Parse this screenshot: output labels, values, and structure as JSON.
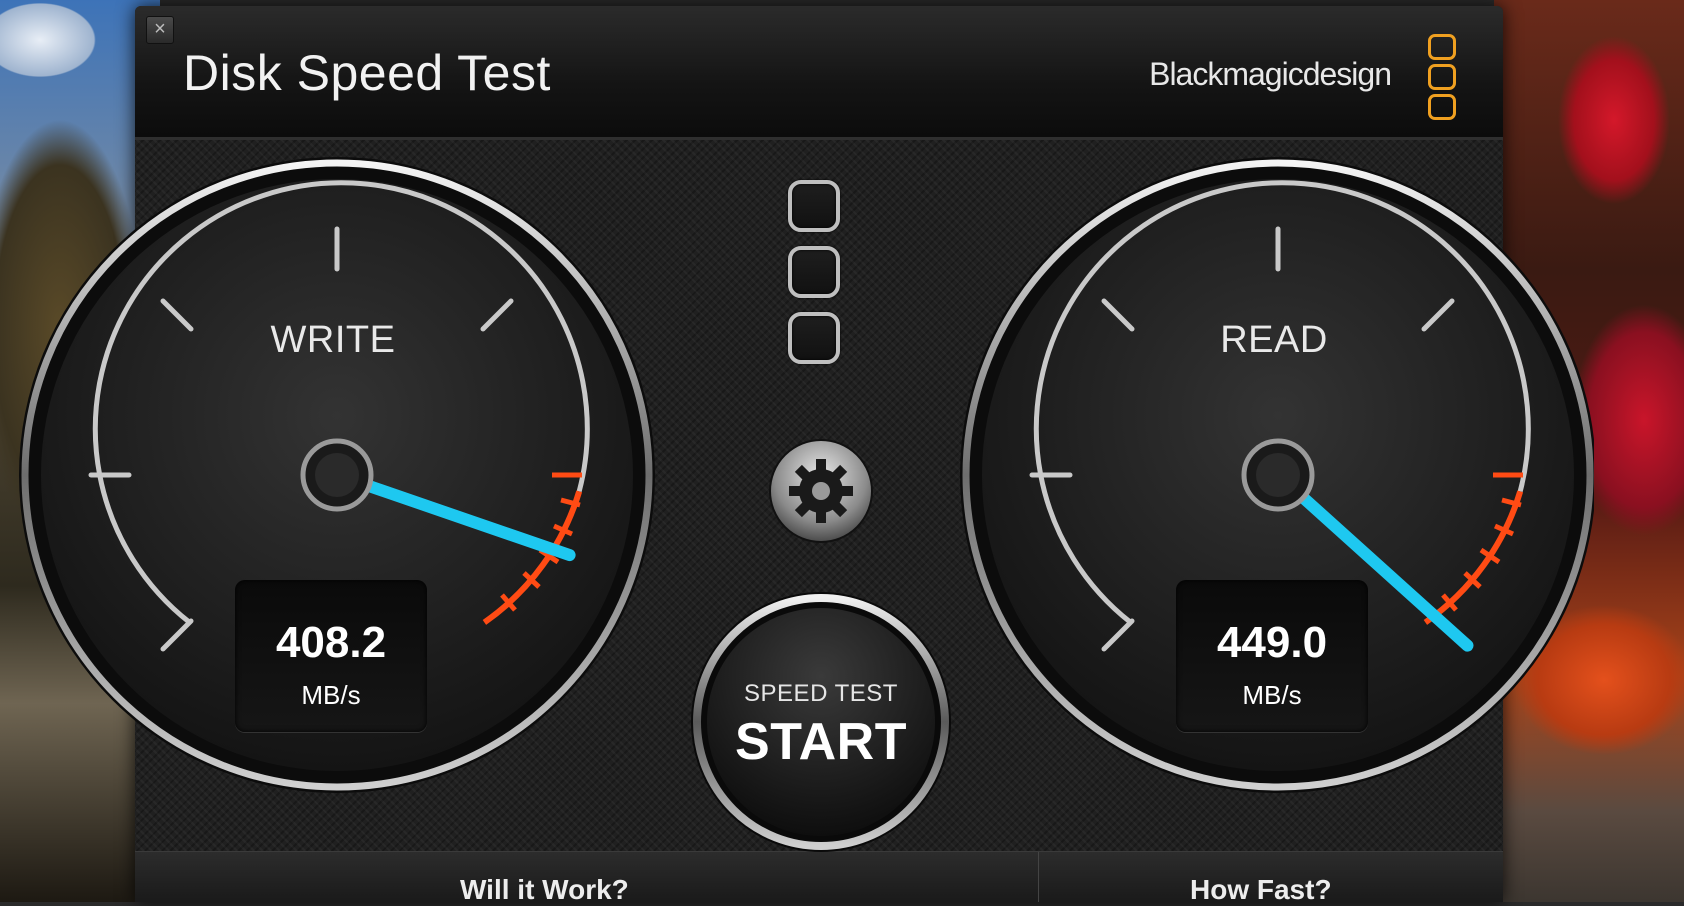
{
  "window": {
    "title": "Disk Speed Test",
    "brand": "Blackmagicdesign",
    "close_glyph": "×"
  },
  "gauges": {
    "write": {
      "label": "WRITE",
      "value": "408.2",
      "unit": "MB/s"
    },
    "read": {
      "label": "READ",
      "value": "449.0",
      "unit": "MB/s"
    }
  },
  "controls": {
    "start_small": "SPEED TEST",
    "start_big": "START",
    "settings_icon": "gear-icon"
  },
  "bottom": {
    "left_label": "Will it Work?",
    "right_label": "How Fast?"
  },
  "colors": {
    "needle": "#1ec8f0",
    "redline": "#ff3a10",
    "brand_logo": "#f0a020"
  }
}
